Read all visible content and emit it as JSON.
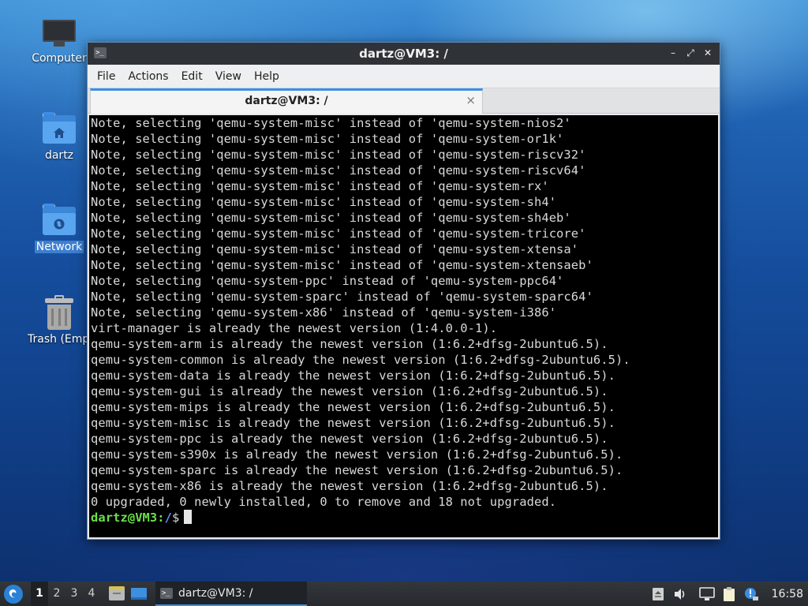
{
  "desktop": {
    "icons": [
      {
        "label": "Computer"
      },
      {
        "label": "dartz"
      },
      {
        "label": "Network"
      },
      {
        "label": "Trash (Empty)"
      }
    ]
  },
  "window": {
    "title": "dartz@VM3: /",
    "menu": [
      "File",
      "Actions",
      "Edit",
      "View",
      "Help"
    ],
    "tab": {
      "label": "dartz@VM3: /",
      "close": "×"
    },
    "controls": {
      "minimize": "–",
      "maximize": "⤢",
      "close": "✕"
    }
  },
  "terminal": {
    "lines": [
      "Note, selecting 'qemu-system-misc' instead of 'qemu-system-nios2'",
      "Note, selecting 'qemu-system-misc' instead of 'qemu-system-or1k'",
      "Note, selecting 'qemu-system-misc' instead of 'qemu-system-riscv32'",
      "Note, selecting 'qemu-system-misc' instead of 'qemu-system-riscv64'",
      "Note, selecting 'qemu-system-misc' instead of 'qemu-system-rx'",
      "Note, selecting 'qemu-system-misc' instead of 'qemu-system-sh4'",
      "Note, selecting 'qemu-system-misc' instead of 'qemu-system-sh4eb'",
      "Note, selecting 'qemu-system-misc' instead of 'qemu-system-tricore'",
      "Note, selecting 'qemu-system-misc' instead of 'qemu-system-xtensa'",
      "Note, selecting 'qemu-system-misc' instead of 'qemu-system-xtensaeb'",
      "Note, selecting 'qemu-system-ppc' instead of 'qemu-system-ppc64'",
      "Note, selecting 'qemu-system-sparc' instead of 'qemu-system-sparc64'",
      "Note, selecting 'qemu-system-x86' instead of 'qemu-system-i386'",
      "virt-manager is already the newest version (1:4.0.0-1).",
      "qemu-system-arm is already the newest version (1:6.2+dfsg-2ubuntu6.5).",
      "qemu-system-common is already the newest version (1:6.2+dfsg-2ubuntu6.5).",
      "qemu-system-data is already the newest version (1:6.2+dfsg-2ubuntu6.5).",
      "qemu-system-gui is already the newest version (1:6.2+dfsg-2ubuntu6.5).",
      "qemu-system-mips is already the newest version (1:6.2+dfsg-2ubuntu6.5).",
      "qemu-system-misc is already the newest version (1:6.2+dfsg-2ubuntu6.5).",
      "qemu-system-ppc is already the newest version (1:6.2+dfsg-2ubuntu6.5).",
      "qemu-system-s390x is already the newest version (1:6.2+dfsg-2ubuntu6.5).",
      "qemu-system-sparc is already the newest version (1:6.2+dfsg-2ubuntu6.5).",
      "qemu-system-x86 is already the newest version (1:6.2+dfsg-2ubuntu6.5).",
      "0 upgraded, 0 newly installed, 0 to remove and 18 not upgraded."
    ],
    "prompt": {
      "user_host": "dartz@VM3",
      "sep": ":",
      "path": "/",
      "symbol": "$"
    }
  },
  "taskbar": {
    "workspaces": [
      "1",
      "2",
      "3",
      "4"
    ],
    "active_workspace": "1",
    "task": {
      "label": "dartz@VM3: /"
    },
    "clock": "16:58"
  },
  "colors": {
    "accent": "#3d8ee8",
    "prompt_user": "#6ae04b",
    "prompt_path": "#6a8dff",
    "terminal_bg": "#000000",
    "terminal_fg": "#d9d9d9"
  },
  "icons": {
    "computer": "monitor-icon",
    "home_folder": "home-folder-icon",
    "network": "network-folder-icon",
    "trash": "trash-icon",
    "start": "start-menu-icon",
    "file_manager": "file-manager-icon",
    "show_desktop": "show-desktop-icon",
    "terminal": "terminal-icon",
    "notes": "notes-icon",
    "volume": "volume-icon",
    "network_tray": "network-tray-icon",
    "clipboard": "clipboard-icon",
    "update": "update-notifier-icon"
  }
}
